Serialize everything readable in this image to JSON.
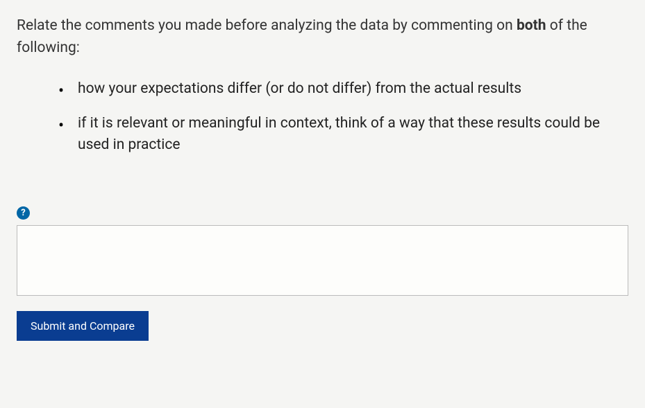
{
  "prompt": {
    "prefix": "Relate the comments you made before analyzing the data by commenting on ",
    "bold_word": "both",
    "suffix": " of the following:"
  },
  "bullets": [
    "how your expectations differ (or do not differ) from the actual results",
    "if it is relevant or meaningful in context, think of a way that these results could be used in practice"
  ],
  "help_icon_label": "?",
  "answer_value": "",
  "submit_label": "Submit and Compare"
}
